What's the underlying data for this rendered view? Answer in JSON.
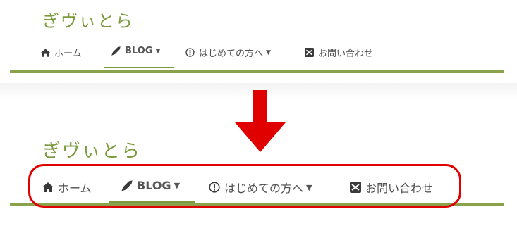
{
  "site": {
    "title": "ぎヴぃとら"
  },
  "nav": {
    "items": [
      {
        "label": "ホーム",
        "icon": "home-icon"
      },
      {
        "label": "BLOG",
        "icon": "pen-nib-icon",
        "dropdown": true,
        "active": true
      },
      {
        "label": "はじめての方へ",
        "icon": "exclamation-circle-icon",
        "dropdown": true
      },
      {
        "label": "お問い合わせ",
        "icon": "envelope-icon"
      }
    ]
  },
  "colors": {
    "accent": "#7a9a3c",
    "nav_text": "#505050",
    "annotation": "#e00000"
  }
}
